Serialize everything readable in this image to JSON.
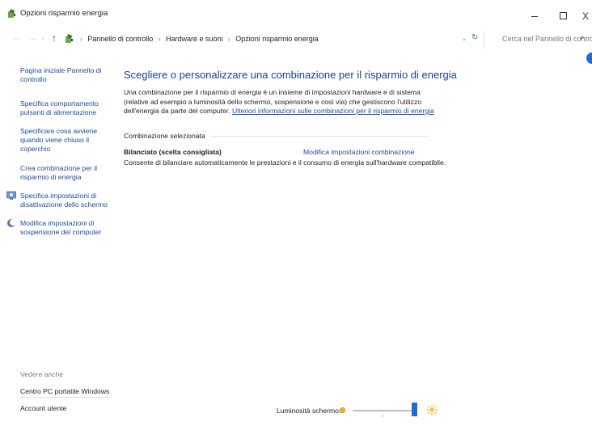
{
  "window": {
    "title": "Opzioni risparmio energia",
    "controls": {
      "minimize_icon": "minimize-icon",
      "maximize_icon": "maximize-icon",
      "close_label": "X"
    }
  },
  "address": {
    "back_icon": "←",
    "forward_icon": "→",
    "recent_icon": "⌄",
    "up_icon": "↑",
    "crumbs": [
      "Pannello di controllo",
      "Hardware e suoni",
      "Opzioni risparmio energia"
    ],
    "separator": "›",
    "dropdown_icon": "⌄",
    "refresh_icon": "↻",
    "search_placeholder": "Cerca nel Pannello di controllo",
    "search_icon": "⌕"
  },
  "sidebar": {
    "links": [
      "Pagina iniziale Pannello di controllo",
      "Specifica comportamento pulsanti di alimentazione",
      "Specificare cosa avviene quando viene chiuso il coperchio",
      "Crea combinazione per il risparmio di energia",
      "Specifica impostazioni di disattivazione dello schermo",
      "Modifica impostazioni di sospensione del computer"
    ],
    "see_also": "Vedere anche",
    "bottom_links": [
      "Centro PC portatile Windows",
      "Account utente"
    ]
  },
  "main": {
    "heading": "Scegliere o personalizzare una combinazione per il risparmio di energia",
    "intro": "Una combinazione per il risparmio di energia è un insieme di impostazioni hardware e di sistema (relative ad esempio a luminosità dello schermo, sospensione e così via) che gestiscono l'utilizzo dell'energia da parte del computer.",
    "intro_link": "Ulteriori informazioni sulle combinazioni per il risparmio di energia",
    "group_label": "Combinazione selezionata",
    "plan": {
      "name": "Bilanciato (scelta consigliata)",
      "change_link": "Modifica impostazioni combinazione",
      "description": "Consente di bilanciare automaticamente le prestazioni e il consumo di energia sull'hardware compatibile."
    }
  },
  "brightness": {
    "label": "Luminosità schermo:",
    "level_percent": 100
  },
  "colors": {
    "link": "#1c4a9c",
    "heading": "#1c3f94",
    "accent": "#1e6ad6",
    "sun": "#f0b428"
  }
}
